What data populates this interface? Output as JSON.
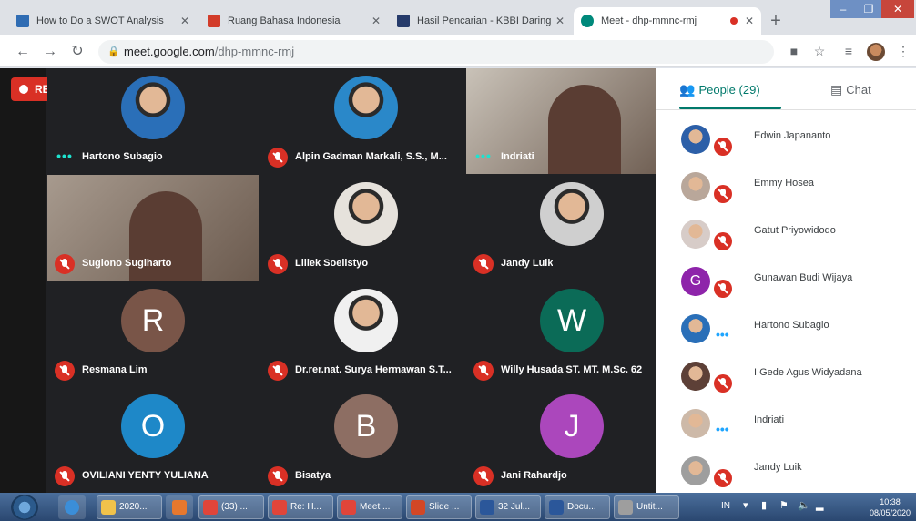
{
  "browser": {
    "tabs": [
      {
        "title": "How to Do a SWOT Analysis",
        "fav_color": "#2f6cb3",
        "active": false
      },
      {
        "title": "Ruang Bahasa Indonesia",
        "fav_color": "#d23c2a",
        "active": false
      },
      {
        "title": "Hasil Pencarian - KBBI Daring",
        "fav_color": "#263b6b",
        "active": false
      },
      {
        "title": "Meet - dhp-mmnc-rmj",
        "fav_color": "#00897b",
        "active": true
      }
    ],
    "url_host": "meet.google.com",
    "url_path": "/dhp-mmnc-rmj"
  },
  "meeting": {
    "rec_label": "REC",
    "tiles": [
      {
        "name": "Hartono Subagio",
        "kind": "photo",
        "status": "speaking",
        "bg": "#2a6fb8"
      },
      {
        "name": "Alpin Gadman Markali, S.S., M...",
        "kind": "photo",
        "status": "muted",
        "bg": "#2a88c9"
      },
      {
        "name": "Indriati",
        "kind": "video",
        "status": "speaking",
        "bg": "#c9c2b8"
      },
      {
        "name": "Sugiono Sugiharto",
        "kind": "video",
        "status": "muted",
        "bg": "#a79a8e"
      },
      {
        "name": "Liliek Soelistyo",
        "kind": "photo",
        "status": "muted",
        "bg": "#e6e2dc"
      },
      {
        "name": "Jandy Luik",
        "kind": "photo",
        "status": "muted",
        "bg": "#cfcfcf"
      },
      {
        "name": "Resmana Lim",
        "kind": "initial",
        "initial": "R",
        "status": "muted",
        "bg": "#795548"
      },
      {
        "name": "Dr.rer.nat. Surya Hermawan S.T...",
        "kind": "photo",
        "status": "muted",
        "bg": "#f0f0f0"
      },
      {
        "name": "Willy Husada ST. MT. M.Sc. 62",
        "kind": "initial",
        "initial": "W",
        "status": "muted",
        "bg": "#0b6b57"
      },
      {
        "name": "OVILIANI YENTY YULIANA",
        "kind": "initial",
        "initial": "O",
        "status": "muted",
        "bg": "#1e88c8"
      },
      {
        "name": "Bisatya",
        "kind": "initial",
        "initial": "B",
        "status": "muted",
        "bg": "#8d6e63"
      },
      {
        "name": "Jani Rahardjo",
        "kind": "initial",
        "initial": "J",
        "status": "muted",
        "bg": "#ab47bc"
      }
    ]
  },
  "panel": {
    "people_label": "People (29)",
    "chat_label": "Chat",
    "people": [
      {
        "name": "Edwin Japananto",
        "kind": "photo",
        "status": "muted",
        "bg": "#2c5fa8"
      },
      {
        "name": "Emmy Hosea",
        "kind": "photo",
        "status": "muted",
        "bg": "#b9a79a"
      },
      {
        "name": "Gatut Priyowidodo",
        "kind": "photo",
        "status": "muted",
        "bg": "#d7ccc8"
      },
      {
        "name": "Gunawan Budi Wijaya",
        "kind": "initial",
        "initial": "G",
        "status": "muted",
        "bg": "#8e24aa"
      },
      {
        "name": "Hartono Subagio",
        "kind": "photo",
        "status": "speaking",
        "bg": "#2a6fb8"
      },
      {
        "name": "I Gede Agus Widyadana",
        "kind": "photo",
        "status": "muted",
        "bg": "#5d4037"
      },
      {
        "name": "Indriati",
        "kind": "photo",
        "status": "speaking",
        "bg": "#cdb9a8"
      },
      {
        "name": "Jandy Luik",
        "kind": "photo",
        "status": "muted",
        "bg": "#9e9e9e"
      }
    ]
  },
  "taskbar": {
    "items": [
      {
        "label": "2020...",
        "color": "#f0c24b",
        "type": "item"
      },
      {
        "label": "",
        "color": "#e6782e",
        "type": "icon"
      },
      {
        "label": "(33) ...",
        "color": "#e0453a",
        "type": "item"
      },
      {
        "label": "Re: H...",
        "color": "#e0453a",
        "type": "item"
      },
      {
        "label": "Meet ...",
        "color": "#e0453a",
        "type": "item"
      },
      {
        "label": "Slide ...",
        "color": "#d24726",
        "type": "item"
      },
      {
        "label": "32 Jul...",
        "color": "#2b579a",
        "type": "item"
      },
      {
        "label": "Docu...",
        "color": "#2b579a",
        "type": "item"
      },
      {
        "label": "Untit...",
        "color": "#9e9e9e",
        "type": "item"
      }
    ],
    "lang": "IN",
    "time": "10:38",
    "date": "08/05/2020"
  }
}
